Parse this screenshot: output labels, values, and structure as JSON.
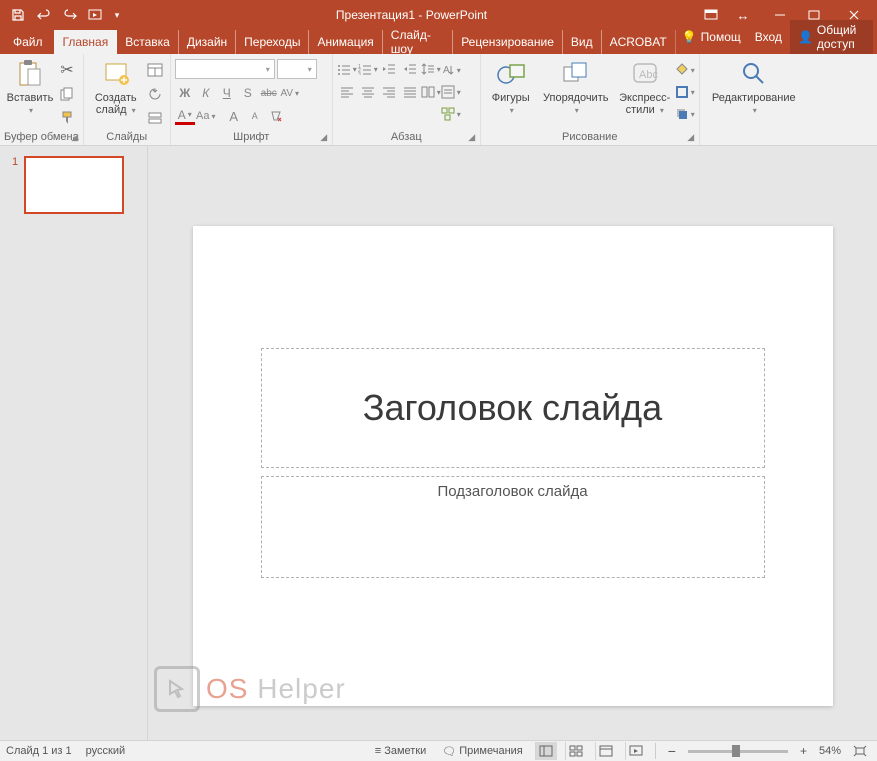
{
  "titlebar": {
    "title": "Презентация1 - PowerPoint"
  },
  "tabs": {
    "file": "Файл",
    "home": "Главная",
    "insert": "Вставка",
    "design": "Дизайн",
    "transitions": "Переходы",
    "animations": "Анимация",
    "slideshow": "Слайд-шоу",
    "review": "Рецензирование",
    "view": "Вид",
    "acrobat": "ACROBAT",
    "help": "Помощ",
    "signin": "Вход",
    "share": "Общий доступ"
  },
  "ribbon": {
    "clipboard": {
      "paste": "Вставить",
      "group": "Буфер обмена"
    },
    "slides": {
      "new_slide_line1": "Создать",
      "new_slide_line2": "слайд",
      "group": "Слайды"
    },
    "font": {
      "bold": "Ж",
      "italic": "К",
      "underline": "Ч",
      "shadow": "S",
      "strike": "abc",
      "spacing": "AV",
      "fontcolor": "A",
      "clear": "Aa",
      "grow": "A",
      "shrink": "A",
      "group": "Шрифт"
    },
    "paragraph": {
      "group": "Абзац"
    },
    "drawing": {
      "shapes": "Фигуры",
      "arrange": "Упорядочить",
      "quick_line1": "Экспресс-",
      "quick_line2": "стили",
      "group": "Рисование"
    },
    "editing": {
      "label": "Редактирование"
    }
  },
  "thumbnails": {
    "items": [
      {
        "num": "1"
      }
    ]
  },
  "slide": {
    "title_placeholder": "Заголовок слайда",
    "subtitle_placeholder": "Подзаголовок слайда"
  },
  "watermark": {
    "os": "OS",
    "helper": "Helper"
  },
  "statusbar": {
    "slide_count": "Слайд 1 из 1",
    "language": "русский",
    "notes": "Заметки",
    "comments": "Примечания",
    "zoom_pct": "54%",
    "minus": "−",
    "plus": "+"
  }
}
